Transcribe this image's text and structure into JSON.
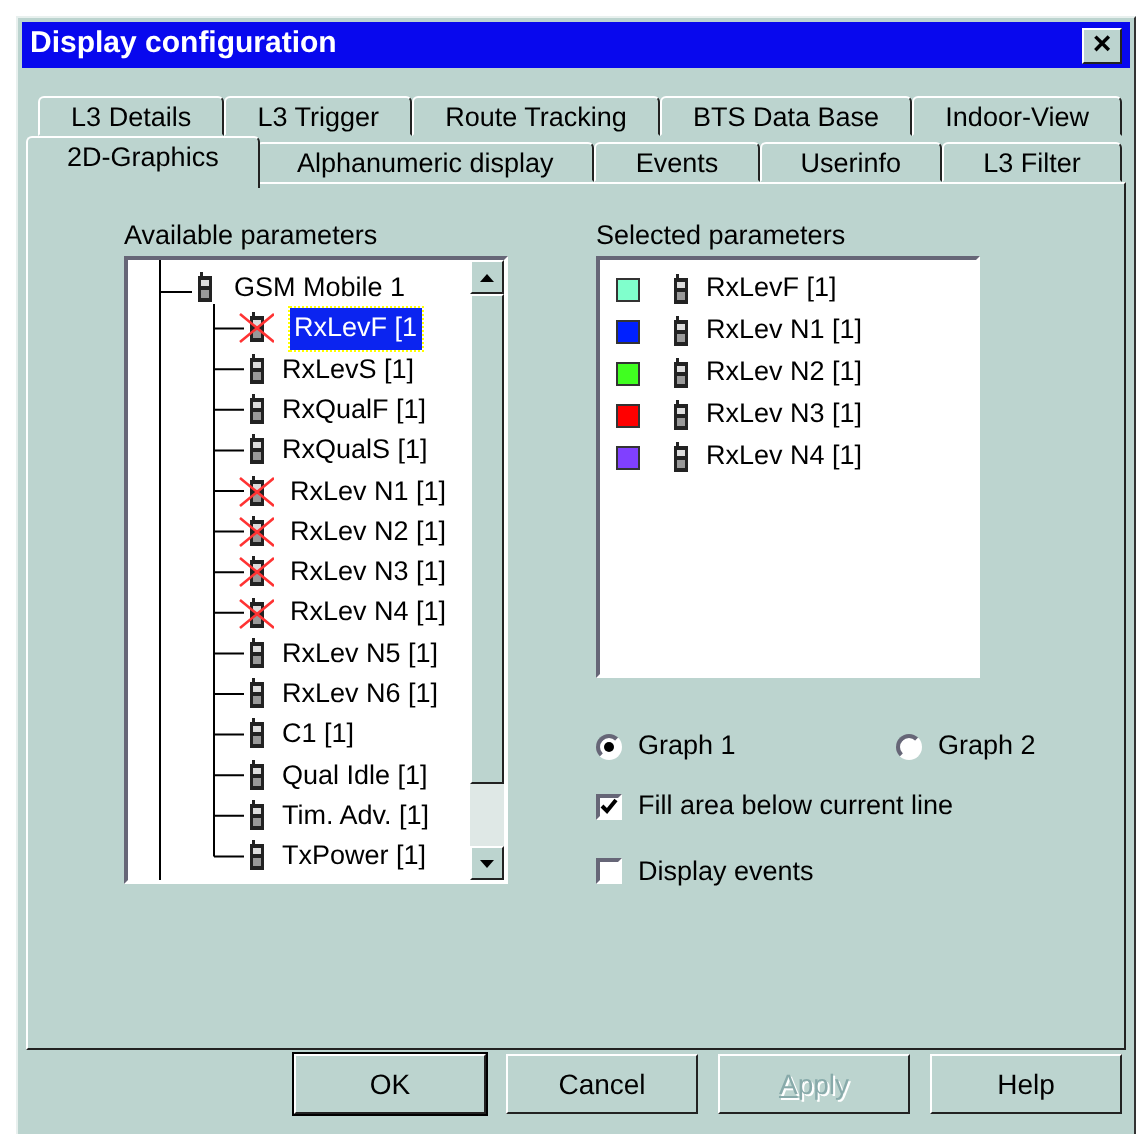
{
  "window": {
    "title": "Display configuration",
    "close": "×"
  },
  "tab_rows": [
    [
      {
        "label": "L3 Details",
        "selected": false
      },
      {
        "label": "L3 Trigger",
        "selected": false
      },
      {
        "label": "Route Tracking",
        "selected": false
      },
      {
        "label": "BTS Data Base",
        "selected": false
      },
      {
        "label": "Indoor-View",
        "selected": false
      }
    ],
    [
      {
        "label": "2D-Graphics",
        "selected": true
      },
      {
        "label": "Alphanumeric display",
        "selected": false
      },
      {
        "label": "Events",
        "selected": false
      },
      {
        "label": "Userinfo",
        "selected": false
      },
      {
        "label": "L3 Filter",
        "selected": false
      }
    ]
  ],
  "available": {
    "label": "Available parameters",
    "tree": [
      {
        "label": "GSM Mobile 1",
        "crossed": false,
        "selected": false,
        "children": [
          {
            "label": "RxLevF [1",
            "crossed": true,
            "selected": true
          },
          {
            "label": "RxLevS [1]",
            "crossed": false,
            "selected": false
          },
          {
            "label": "RxQualF [1]",
            "crossed": false,
            "selected": false
          },
          {
            "label": "RxQualS [1]",
            "crossed": false,
            "selected": false
          },
          {
            "label": "RxLev N1 [1]",
            "crossed": true,
            "selected": false
          },
          {
            "label": "RxLev N2 [1]",
            "crossed": true,
            "selected": false
          },
          {
            "label": "RxLev N3 [1]",
            "crossed": true,
            "selected": false
          },
          {
            "label": "RxLev N4 [1]",
            "crossed": true,
            "selected": false
          },
          {
            "label": "RxLev N5 [1]",
            "crossed": false,
            "selected": false
          },
          {
            "label": "RxLev N6 [1]",
            "crossed": false,
            "selected": false
          },
          {
            "label": "C1 [1]",
            "crossed": false,
            "selected": false
          },
          {
            "label": "Qual Idle [1]",
            "crossed": false,
            "selected": false
          },
          {
            "label": "Tim. Adv. [1]",
            "crossed": false,
            "selected": false
          },
          {
            "label": "TxPower [1]",
            "crossed": false,
            "selected": false
          }
        ]
      }
    ]
  },
  "selected_params": {
    "label": "Selected parameters",
    "items": [
      {
        "label": "RxLevF [1]",
        "color": "#80ffcc"
      },
      {
        "label": "RxLev N1 [1]",
        "color": "#0020ff"
      },
      {
        "label": "RxLev N2 [1]",
        "color": "#40ff20"
      },
      {
        "label": "RxLev N3 [1]",
        "color": "#ff0000"
      },
      {
        "label": "RxLev N4 [1]",
        "color": "#8040ff"
      }
    ]
  },
  "graphs": [
    {
      "label": "Graph 1",
      "selected": true
    },
    {
      "label": "Graph 2",
      "selected": false
    }
  ],
  "options": [
    {
      "label": "Fill area below current line",
      "checked": true
    },
    {
      "label": "Display events",
      "checked": false
    }
  ],
  "buttons": [
    {
      "label": "OK",
      "default": true,
      "disabled": false
    },
    {
      "label": "Cancel",
      "default": false,
      "disabled": false
    },
    {
      "label": "Apply",
      "default": false,
      "disabled": true
    },
    {
      "label": "Help",
      "default": false,
      "disabled": false
    }
  ]
}
